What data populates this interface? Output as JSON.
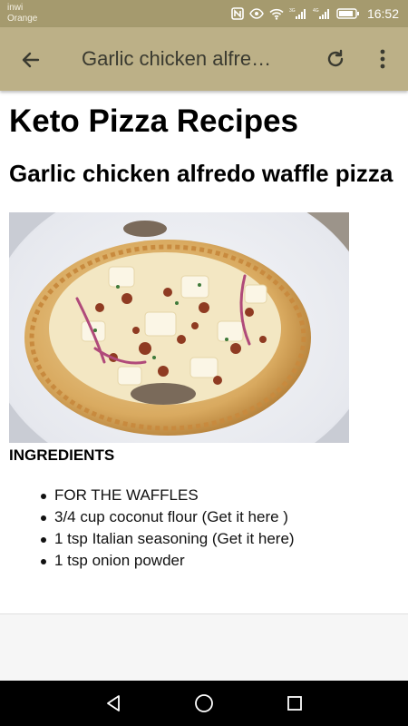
{
  "status_bar": {
    "carrier_line1": "inwi",
    "carrier_line2": "Orange",
    "time": "16:52",
    "icons": [
      "nfc-icon",
      "eye-icon",
      "wifi-icon",
      "signal-3g-icon",
      "signal-4g-icon",
      "battery-icon"
    ],
    "signal_labels": [
      "3G",
      "4G"
    ]
  },
  "app_bar": {
    "title": "Garlic chicken alfre…",
    "back_icon": "arrow-left-icon",
    "refresh_icon": "refresh-icon",
    "more_icon": "more-vertical-icon"
  },
  "content": {
    "page_title": "Keto Pizza Recipes",
    "recipe_title": "Garlic chicken alfredo waffle pizza",
    "ingredients_heading": "INGREDIENTS",
    "ingredients": [
      "FOR THE WAFFLES",
      "3/4 cup coconut flour (Get it here )",
      "1 tsp Italian seasoning (Get it here)",
      "1 tsp onion powder"
    ]
  },
  "nav_bar": {
    "icons": [
      "back-triangle-icon",
      "home-circle-icon",
      "recents-square-icon"
    ]
  },
  "colors": {
    "status_bar": "#a59a6e",
    "app_bar": "#bcb087",
    "title_text": "#3a3a30",
    "nav_bar": "#000000"
  }
}
